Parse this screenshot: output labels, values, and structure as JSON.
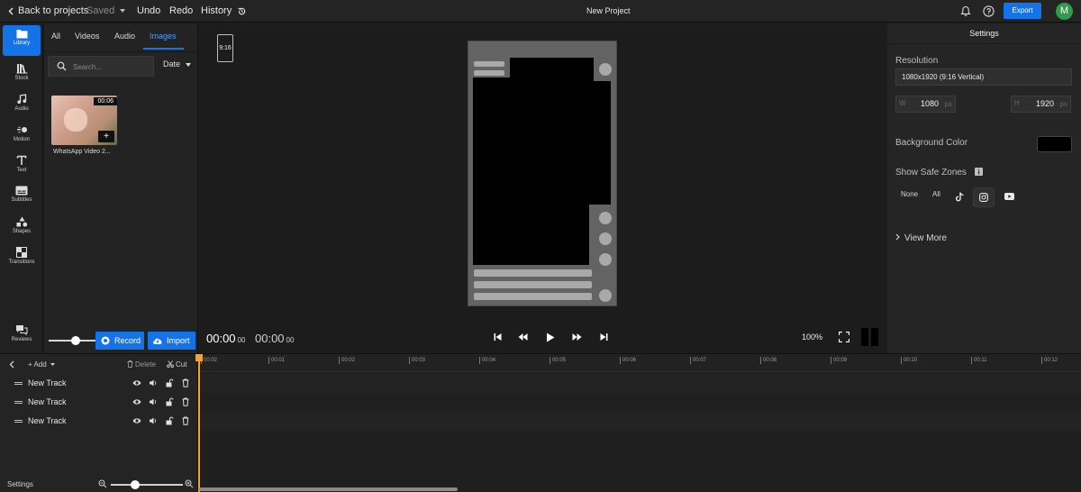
{
  "topbar": {
    "back_label": "Back to projects",
    "saved_label": "Saved",
    "undo_label": "Undo",
    "redo_label": "Redo",
    "history_label": "History",
    "project_title": "New Project",
    "export_label": "Export",
    "avatar_initial": "M"
  },
  "nav": {
    "items": [
      {
        "label": "Library",
        "icon": "folder-icon"
      },
      {
        "label": "Stock",
        "icon": "books-icon"
      },
      {
        "label": "Audio",
        "icon": "music-note-icon"
      },
      {
        "label": "Motion",
        "icon": "motion-icon"
      },
      {
        "label": "Text",
        "icon": "text-icon"
      },
      {
        "label": "Subtitles",
        "icon": "subtitles-icon"
      },
      {
        "label": "Shapes",
        "icon": "shapes-icon"
      },
      {
        "label": "Transitions",
        "icon": "transitions-icon"
      },
      {
        "label": "Reviews",
        "icon": "chat-icon"
      }
    ]
  },
  "library": {
    "tabs": [
      {
        "label": "All"
      },
      {
        "label": "Videos"
      },
      {
        "label": "Audio"
      },
      {
        "label": "Images"
      }
    ],
    "active_tab": "Images",
    "search_placeholder": "Search...",
    "sort_label": "Date",
    "media": [
      {
        "name": "WhatsApp Video 2...",
        "duration": "00:06",
        "add_label": "+"
      }
    ],
    "record_label": "Record",
    "import_label": "Import"
  },
  "canvas": {
    "aspect_ratio": "9:16",
    "current_time": "00:00",
    "current_frames": "00",
    "total_time": "00:00",
    "total_frames": "00",
    "zoom": "100%"
  },
  "settings": {
    "title": "Settings",
    "resolution_label": "Resolution",
    "resolution_value": "1080x1920 (9:16 Vertical)",
    "width_prefix": "W",
    "width_value": "1080",
    "height_prefix": "H",
    "height_value": "1920",
    "unit": "px",
    "bg_color_label": "Background Color",
    "bg_color": "#000000",
    "safe_zones_label": "Show Safe Zones",
    "safe_zone_options": [
      "None",
      "All"
    ],
    "safe_zone_icons": [
      "tiktok-icon",
      "instagram-icon",
      "youtube-icon"
    ],
    "view_more_label": "View More"
  },
  "timeline": {
    "add_label": "Add",
    "delete_label": "Delete",
    "cut_label": "Cut",
    "settings_label": "Settings",
    "ticks": [
      "00:02",
      "00:01",
      "00:02",
      "00:03",
      "00:04",
      "00:05",
      "00:06",
      "00:07",
      "00:08",
      "00:09",
      "00:10",
      "00:11",
      "00:12"
    ],
    "tracks": [
      {
        "name": "New Track"
      },
      {
        "name": "New Track"
      },
      {
        "name": "New Track"
      }
    ]
  },
  "colors": {
    "accent": "#1473e6",
    "playhead": "#f5a623",
    "avatar": "#2e9c4a"
  }
}
